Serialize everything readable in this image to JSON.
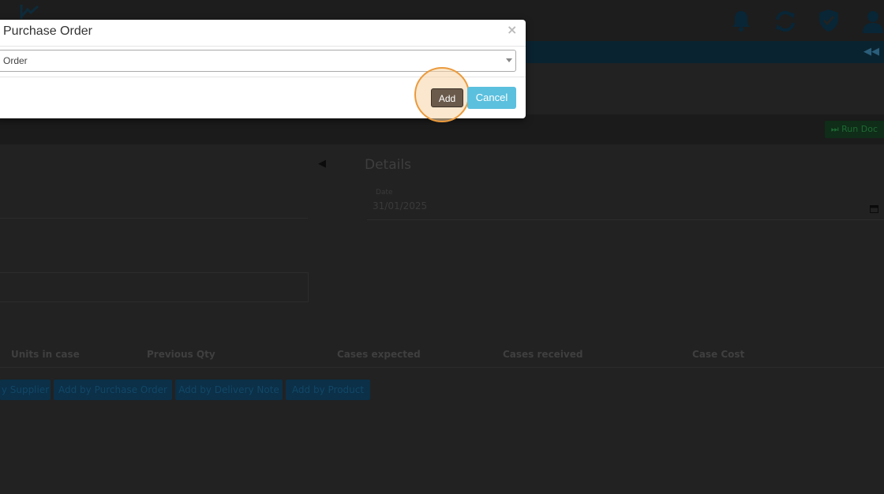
{
  "modal": {
    "title": "Purchase Order",
    "close_symbol": "×",
    "select_value": "Order",
    "add_label": "Add",
    "cancel_label": "Cancel"
  },
  "header": {
    "icons": [
      "logo-icon",
      "bell-icon",
      "refresh-icon",
      "shield-check-icon",
      "user-icon"
    ]
  },
  "toolbar": {
    "run_label": "⏭ Run Doc",
    "strip_arrows": "◀◀"
  },
  "details": {
    "title": "Details",
    "date_label": "Date",
    "date_value": "31/01/2025"
  },
  "table": {
    "columns": [
      "Units in case",
      "Previous Qty",
      "Cases expected",
      "Cases received",
      "Case Cost"
    ]
  },
  "actions": {
    "buttons": [
      "y Supplier",
      "Add by Purchase Order",
      "Add by Delivery Note",
      "Add by Product"
    ]
  },
  "colors": {
    "overlay_bg": "#222222",
    "add_button": "#6a5a4b",
    "cancel_button": "#5bc0de",
    "highlight": "#eb9a3c"
  }
}
